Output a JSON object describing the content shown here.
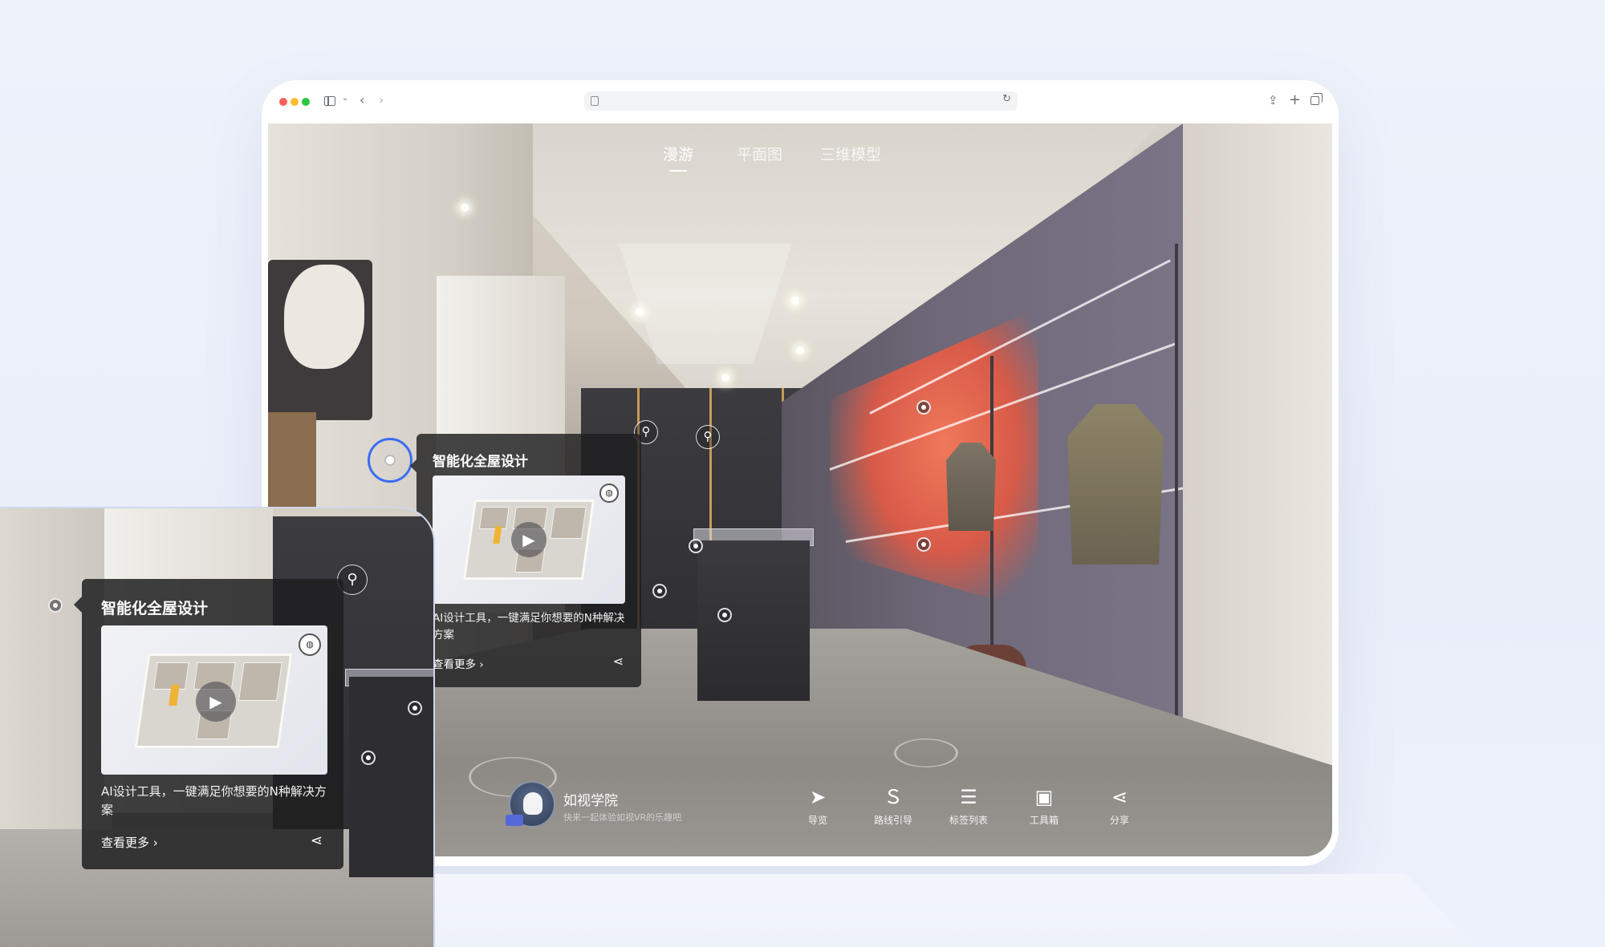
{
  "browser": {
    "address_value": "",
    "reader_icon": "reader-icon",
    "reload_icon": "reload-icon"
  },
  "viewer": {
    "mode_tabs": [
      {
        "label": "漫游",
        "active": true
      },
      {
        "label": "平面图",
        "active": false
      },
      {
        "label": "三维模型",
        "active": false
      }
    ],
    "info_card": {
      "title": "智能化全屋设计",
      "description": "AI设计工具，一键满足你想要的N种解决方案",
      "more_label": "查看更多 ›",
      "share_icon": "share-icon",
      "play_icon": "play-icon",
      "vr_icon": "vr-badge-icon"
    },
    "brand": {
      "name": "如视学院",
      "subtitle": "快来一起体验如视VR的乐趣吧"
    },
    "bottom_bar": [
      {
        "icon": "navigation-icon",
        "glyph": "➤",
        "label": "导览"
      },
      {
        "icon": "route-icon",
        "glyph": "Ｓ",
        "label": "路线引导"
      },
      {
        "icon": "tag-list-icon",
        "glyph": "☰",
        "label": "标签列表"
      },
      {
        "icon": "toolbox-icon",
        "glyph": "▣",
        "label": "工具箱"
      },
      {
        "icon": "share-icon",
        "glyph": "⋖",
        "label": "分享"
      }
    ]
  },
  "inset": {
    "info_card": {
      "title": "智能化全屋设计",
      "description": "AI设计工具，一键满足你想要的N种解决方案",
      "more_label": "查看更多 ›"
    }
  },
  "colors": {
    "page_background": "#eef2fb",
    "selection_ring": "#3b6cf5",
    "card_background": "#1e1e20",
    "closet_glow": "#e8694f"
  }
}
